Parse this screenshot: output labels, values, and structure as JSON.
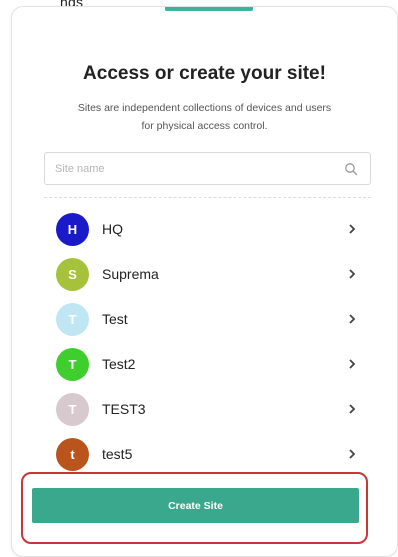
{
  "header_fragment": "ngs",
  "title": "Access or create your site!",
  "subtitle": "Sites are independent collections of devices and users for physical access control.",
  "search": {
    "placeholder": "Site name",
    "value": ""
  },
  "sites": [
    {
      "initial": "H",
      "name": "HQ",
      "color": "#1a1ac8"
    },
    {
      "initial": "S",
      "name": "Suprema",
      "color": "#a6c23a"
    },
    {
      "initial": "T",
      "name": "Test",
      "color": "#bfe6f2"
    },
    {
      "initial": "T",
      "name": "Test2",
      "color": "#3ecf2e"
    },
    {
      "initial": "T",
      "name": "TEST3",
      "color": "#d8c9cf"
    },
    {
      "initial": "t",
      "name": "test5",
      "color": "#b8541c"
    }
  ],
  "create_button": {
    "label": "Create Site"
  },
  "colors": {
    "accent": "#3bb39a",
    "button": "#3aa88d",
    "highlight": "#c9363a"
  }
}
